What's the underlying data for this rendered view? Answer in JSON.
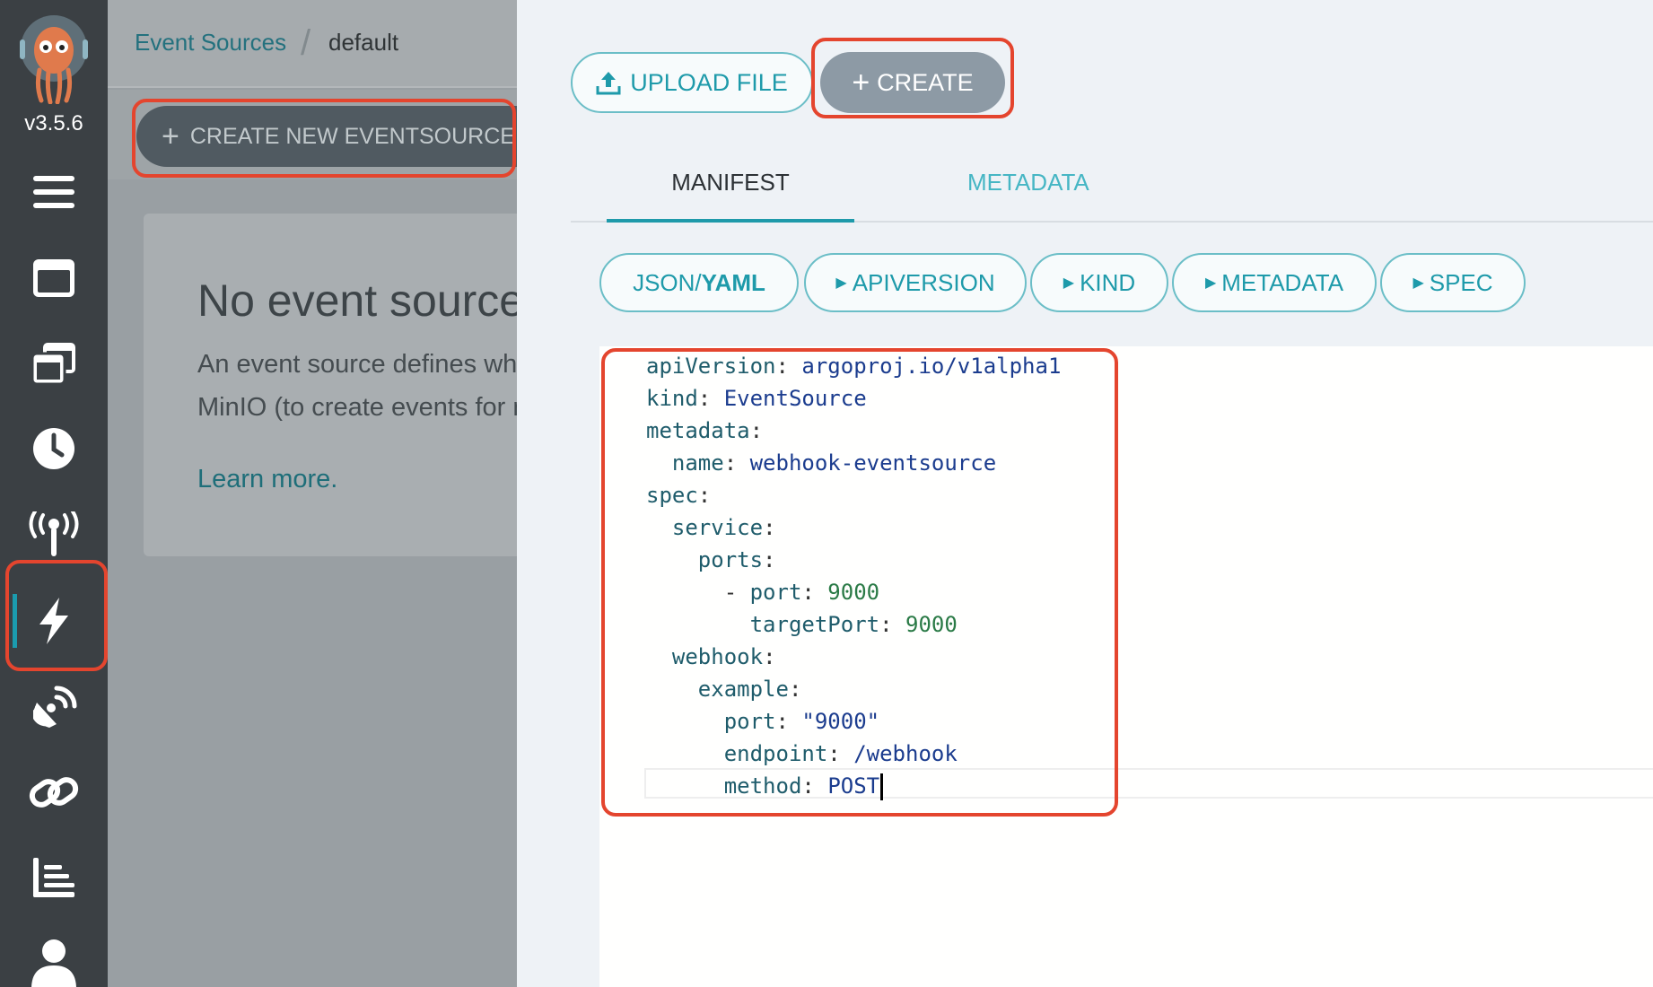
{
  "nav": {
    "version": "v3.5.6",
    "items": [
      "menu-icon",
      "workflow-templates-icon",
      "cluster-templates-icon",
      "cron-workflows-icon",
      "event-flow-icon",
      "event-sources-icon",
      "sensors-icon",
      "link-icon",
      "reports-icon",
      "user-icon"
    ],
    "active": "event-sources-icon",
    "accent": "#1b9bae"
  },
  "breadcrumb": {
    "parent": "Event Sources",
    "current": "default"
  },
  "toolbar": {
    "create_new_label": "CREATE NEW EVENTSOURCE"
  },
  "empty_state": {
    "title": "No event sources",
    "line1": "An event source defines what events can be used to trigger actions. Typical event sources are calender (to create events on schedule) GitHub or GitLab (to create events for each commit), or",
    "line2": "MinIO (to create events for new files in buckets).",
    "learn_more": "Learn more."
  },
  "panel": {
    "upload_label": "UPLOAD FILE",
    "create_label": "CREATE",
    "tabs": [
      "MANIFEST",
      "METADATA"
    ],
    "active_tab": "MANIFEST",
    "chips": {
      "json": "JSON/",
      "yaml": "YAML",
      "apiversion": "APIVERSION",
      "kind": "KIND",
      "metadata": "METADATA",
      "spec": "SPEC"
    }
  },
  "manifest": {
    "l1k": "apiVersion",
    "l1v": "argoproj.io/v1alpha1",
    "l2k": "kind",
    "l2v": "EventSource",
    "l3k": "metadata",
    "l4k": "name",
    "l4v": "webhook-eventsource",
    "l5k": "spec",
    "l6k": "service",
    "l7k": "ports",
    "l8k": "port",
    "l8v": "9000",
    "l9k": "targetPort",
    "l9v": "9000",
    "l10k": "webhook",
    "l11k": "example",
    "l12k": "port",
    "l12v": "\"9000\"",
    "l13k": "endpoint",
    "l13v": "/webhook",
    "l14k": "method",
    "l14v": "POST"
  },
  "highlight_color": "#e4452e"
}
